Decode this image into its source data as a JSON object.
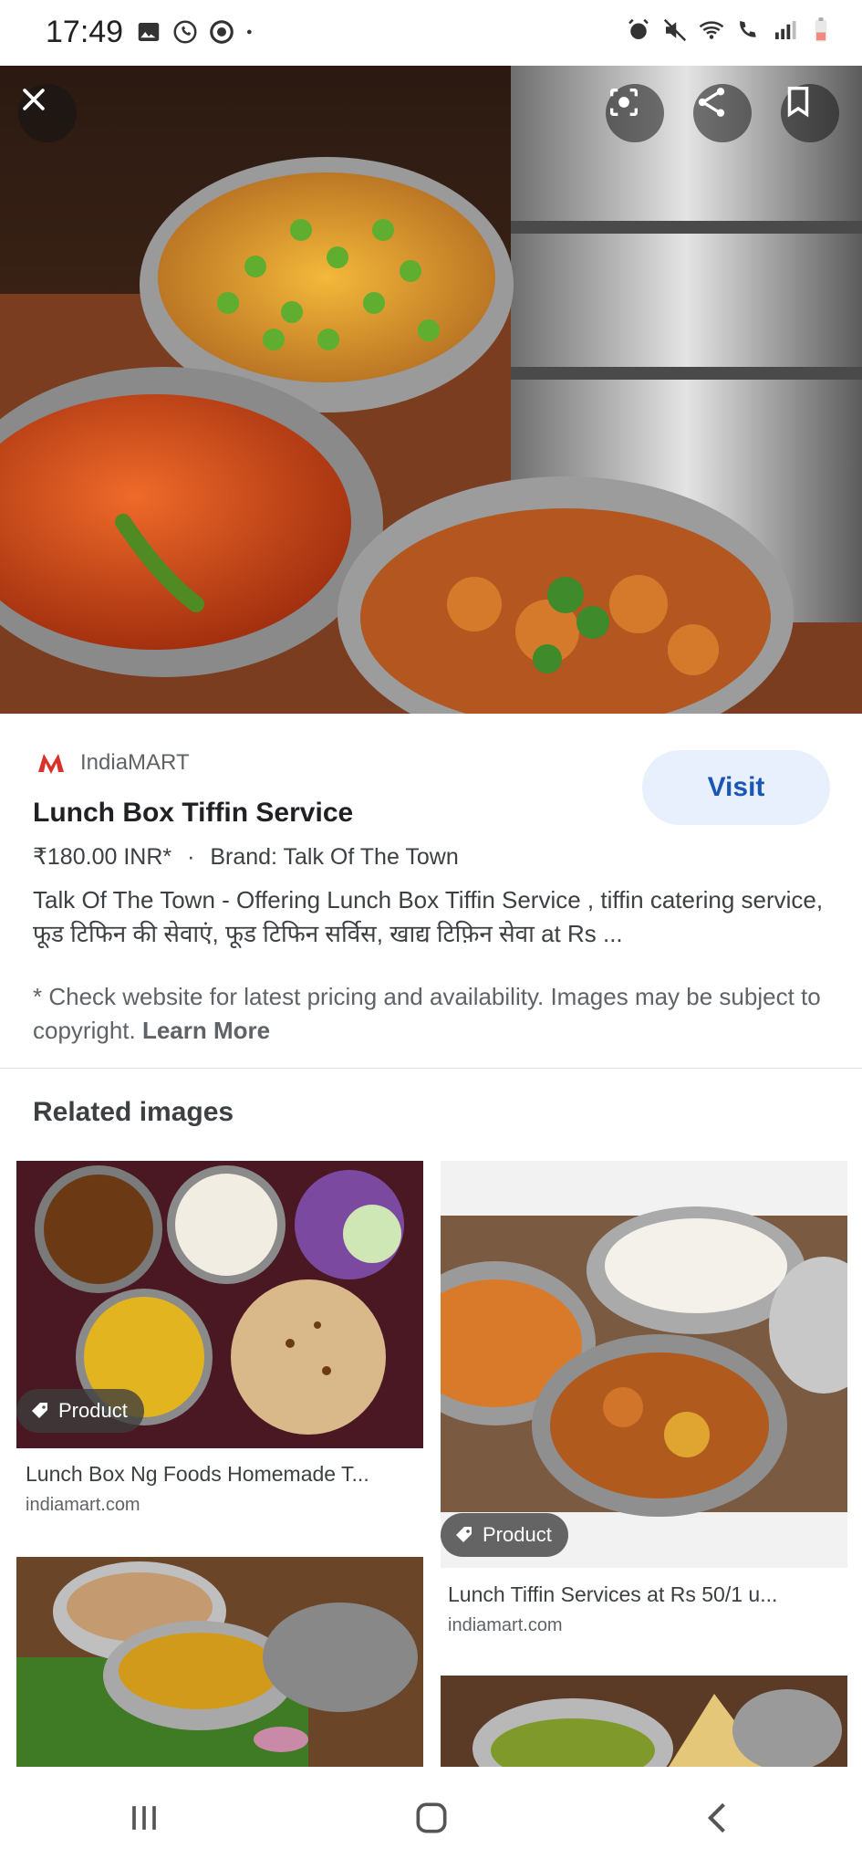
{
  "status_bar": {
    "time": "17:49",
    "left_icons": [
      "gallery-icon",
      "whatsapp-icon",
      "media-icon",
      "dot-icon"
    ],
    "right_icons": [
      "alarm-icon",
      "mute-icon",
      "wifi-icon",
      "call-icon",
      "signal-icon",
      "battery-icon"
    ]
  },
  "hero": {
    "close_icon": "close-icon",
    "lens_icon": "lens-icon",
    "share_icon": "share-icon",
    "bookmark_icon": "bookmark-icon"
  },
  "result": {
    "source": "IndiaMART",
    "title": "Lunch Box Tiffin Service",
    "price": "₹180.00 INR*",
    "separator": "·",
    "brand": "Brand: Talk Of The Town",
    "description": "Talk Of The Town - Offering Lunch Box Tiffin Service , tiffin catering service, फूड टिफिन की सेवाएं, फूड टिफिन सर्विस, खाद्य टिफ़िन सेवा at Rs ...",
    "visit_label": "Visit",
    "disclaimer": "* Check website for latest pricing and availability. Images may be subject to copyright.",
    "learn_more": "Learn More"
  },
  "related": {
    "heading": "Related images",
    "cards": [
      {
        "badge": "Product",
        "title": "Lunch Box Ng Foods Homemade T...",
        "domain": "indiamart.com"
      },
      {
        "badge": "Product",
        "title": "Lunch Tiffin Services at Rs 50/1 u...",
        "domain": "indiamart.com"
      }
    ]
  },
  "nav": {
    "recents_icon": "recents-icon",
    "home_icon": "home-icon",
    "back_icon": "back-icon"
  }
}
